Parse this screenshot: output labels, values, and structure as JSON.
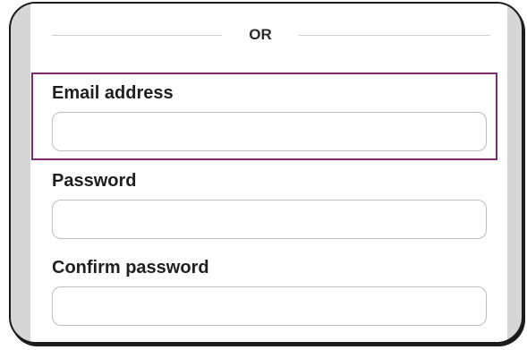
{
  "divider": {
    "text": "OR"
  },
  "fields": [
    {
      "label": "Email address",
      "value": "",
      "placeholder": ""
    },
    {
      "label": "Password",
      "value": "",
      "placeholder": ""
    },
    {
      "label": "Confirm password",
      "value": "",
      "placeholder": ""
    }
  ],
  "colors": {
    "highlight": "#7a2b73",
    "input_border": "#bdbdbd",
    "frame_background": "#d6d6d6"
  }
}
